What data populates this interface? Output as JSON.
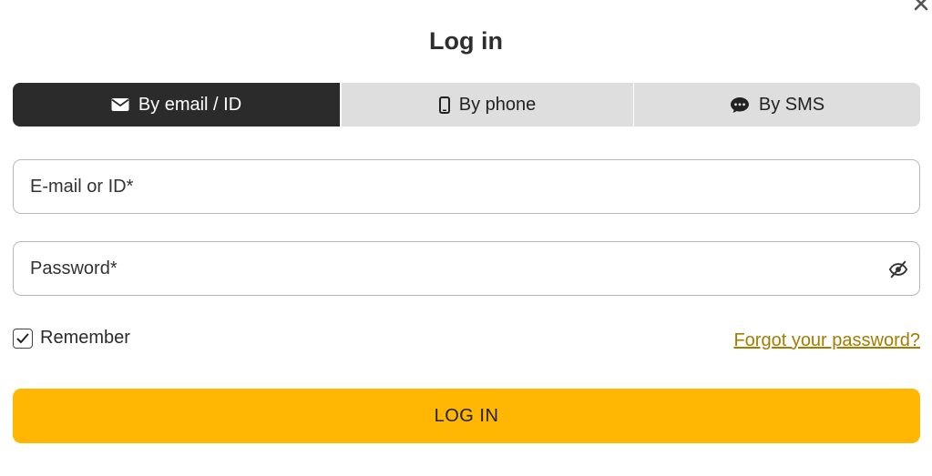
{
  "modal": {
    "title": "Log in",
    "close_icon": "close-icon"
  },
  "tabs": [
    {
      "label": "By email / ID",
      "icon": "envelope-icon",
      "active": true
    },
    {
      "label": "By phone",
      "icon": "phone-icon",
      "active": false
    },
    {
      "label": "By SMS",
      "icon": "chat-bubble-icon",
      "active": false
    }
  ],
  "form": {
    "email_placeholder": "E-mail or ID*",
    "email_value": "",
    "password_placeholder": "Password*",
    "password_value": "",
    "password_toggle_icon": "eye-slash-icon",
    "remember_label": "Remember",
    "remember_checked": true,
    "forgot_label": "Forgot your password?",
    "submit_label": "LOG IN"
  },
  "colors": {
    "active_tab_bg": "#2b2b2b",
    "inactive_tab_bg": "#dedede",
    "accent": "#ffb703",
    "link": "#a57c00"
  }
}
